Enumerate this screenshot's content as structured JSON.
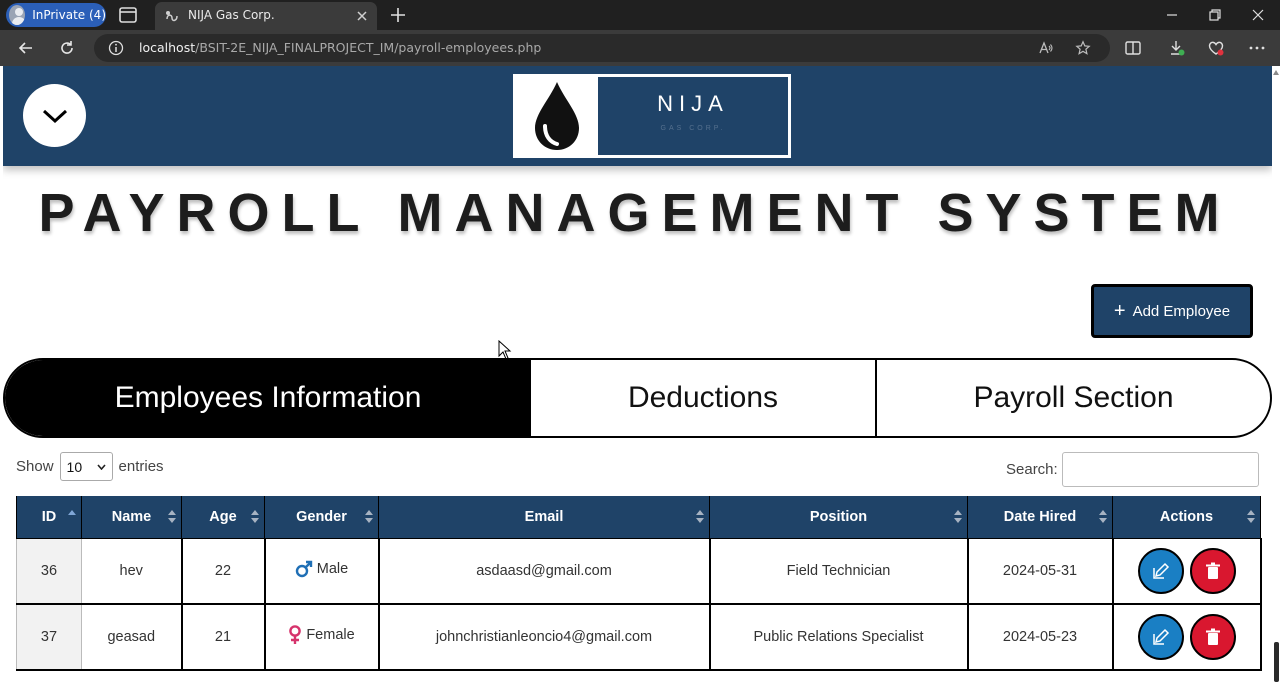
{
  "browser": {
    "profile_label": "InPrivate (4)",
    "tab_title": "NIJA Gas Corp.",
    "url_host": "localhost",
    "url_path": "/BSIT-2E_NIJA_FINALPROJECT_IM/payroll-employees.php"
  },
  "logo": {
    "brand": "NIJA",
    "subtitle": "GAS CORP."
  },
  "page": {
    "title": "PAYROLL MANAGEMENT SYSTEM",
    "add_button": "Add Employee"
  },
  "tabs": [
    {
      "label": "Employees Information",
      "active": true
    },
    {
      "label": "Deductions",
      "active": false
    },
    {
      "label": "Payroll Section",
      "active": false
    }
  ],
  "table_controls": {
    "show_label": "Show",
    "entries_value": "10",
    "entries_label": "entries",
    "search_label": "Search:"
  },
  "table": {
    "columns": [
      "ID",
      "Name",
      "Age",
      "Gender",
      "Email",
      "Position",
      "Date Hired",
      "Actions"
    ],
    "rows": [
      {
        "id": "36",
        "name": "hev",
        "age": "22",
        "gender": "Male",
        "gender_icon": "male-icon",
        "email": "asdaasd@gmail.com",
        "position": "Field Technician",
        "date_hired": "2024-05-31"
      },
      {
        "id": "37",
        "name": "geasad",
        "age": "21",
        "gender": "Female",
        "gender_icon": "female-icon",
        "email": "johnchristianleoncio4@gmail.com",
        "position": "Public Relations Specialist",
        "date_hired": "2024-05-23"
      }
    ]
  },
  "colors": {
    "header_bg": "#1f4368",
    "edit_button": "#1a7fc4",
    "delete_button": "#d9172f",
    "male_icon": "#1f6fb5",
    "female_icon": "#d6336c"
  }
}
